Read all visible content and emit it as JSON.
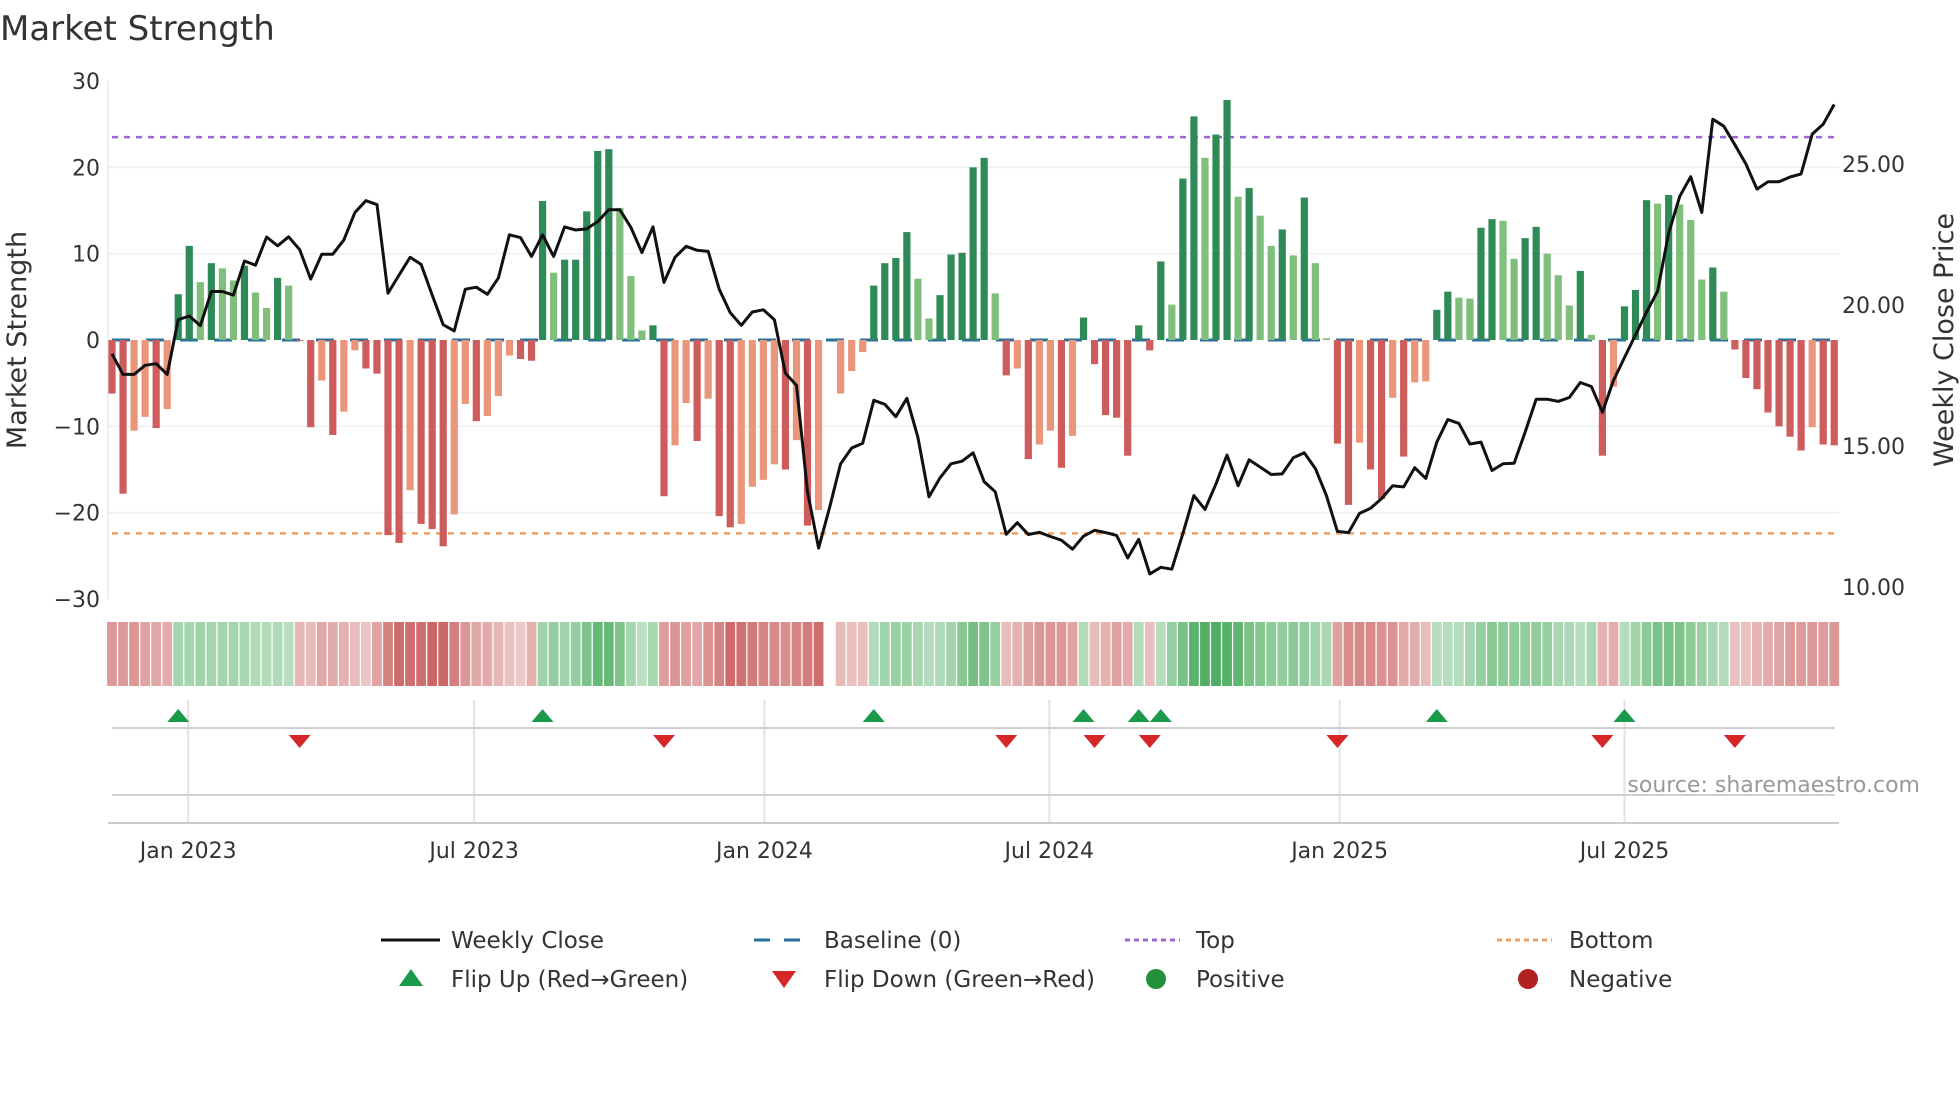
{
  "chart_data": {
    "type": "bar",
    "title": "Market Strength",
    "ylabel": "Market Strength",
    "y2label": "Weekly Close Price",
    "ylim": [
      -30,
      30
    ],
    "y2lim": [
      9.6,
      27.95
    ],
    "yticks": [
      30,
      20,
      10,
      0,
      -10,
      -20,
      -30
    ],
    "yticklabels": [
      "30",
      "20",
      "10",
      "0",
      "−10",
      "−20",
      "−30"
    ],
    "y2ticks": [
      25,
      20,
      15,
      10
    ],
    "y2ticklabels": [
      "25.00",
      "20.00",
      "15.00",
      "10.00"
    ],
    "xticks": [
      {
        "week": 7.9,
        "label": "Jan 2023"
      },
      {
        "week": 33.8,
        "label": "Jul 2023"
      },
      {
        "week": 60.1,
        "label": "Jan 2024"
      },
      {
        "week": 85.9,
        "label": "Jul 2024"
      },
      {
        "week": 112.2,
        "label": "Jan 2025"
      },
      {
        "week": 138.0,
        "label": "Jul 2025"
      }
    ],
    "top_level": 23.5,
    "bottom_level": -22.4,
    "baseline": 0,
    "strength": [
      -6.2,
      -17.8,
      -10.5,
      -8.9,
      -10.2,
      -8.0,
      5.3,
      10.9,
      6.7,
      8.9,
      8.3,
      6.9,
      8.6,
      5.5,
      3.7,
      7.2,
      6.3,
      -0.1,
      -10.1,
      -4.7,
      -11.0,
      -8.3,
      -1.2,
      -3.3,
      -3.9,
      -22.6,
      -23.5,
      -17.4,
      -21.3,
      -21.9,
      -23.9,
      -20.2,
      -7.4,
      -9.4,
      -8.8,
      -6.5,
      -1.8,
      -2.2,
      -2.4,
      16.1,
      7.8,
      9.3,
      9.3,
      14.9,
      21.9,
      22.1,
      15.3,
      7.4,
      1.1,
      1.7,
      -18.1,
      -12.2,
      -7.3,
      -11.7,
      -6.8,
      -20.4,
      -21.7,
      -21.3,
      -17.0,
      -16.2,
      -14.4,
      -15.0,
      -11.6,
      -21.5,
      -19.7,
      null,
      -6.2,
      -3.6,
      -1.4,
      6.3,
      8.9,
      9.5,
      12.5,
      7.1,
      2.5,
      5.2,
      9.9,
      10.1,
      20.0,
      21.1,
      5.4,
      -4.1,
      -3.3,
      -13.8,
      -12.1,
      -10.5,
      -14.8,
      -11.1,
      2.6,
      -2.8,
      -8.7,
      -9.0,
      -13.4,
      1.7,
      -1.2,
      9.1,
      4.1,
      18.7,
      25.9,
      21.1,
      23.8,
      27.8,
      16.6,
      17.6,
      14.4,
      10.9,
      12.8,
      9.8,
      16.5,
      8.9,
      0.2,
      -12.0,
      -19.1,
      -11.9,
      -15.0,
      -18.4,
      -6.7,
      -13.5,
      -4.9,
      -4.8,
      3.5,
      5.6,
      4.9,
      4.8,
      13.0,
      14.0,
      13.8,
      9.4,
      11.8,
      13.1,
      10.0,
      7.5,
      4.0,
      8.0,
      0.6,
      -13.4,
      -5.4,
      3.9,
      5.8,
      16.2,
      15.8,
      16.8,
      15.7,
      13.9,
      7.0,
      8.4,
      5.6,
      -1.1,
      -4.4,
      -5.7,
      -8.4,
      -10.0,
      -11.2,
      -12.8,
      -10.1,
      -12.1,
      -12.2
    ],
    "weekly_close": [
      18.27,
      17.54,
      17.54,
      17.86,
      17.92,
      17.54,
      19.48,
      19.61,
      19.27,
      20.48,
      20.48,
      20.35,
      21.56,
      21.41,
      22.41,
      22.1,
      22.42,
      21.96,
      20.92,
      21.8,
      21.8,
      22.3,
      23.28,
      23.7,
      23.56,
      20.42,
      21.06,
      21.69,
      21.44,
      20.35,
      19.3,
      19.08,
      20.56,
      20.63,
      20.38,
      20.96,
      22.49,
      22.39,
      21.72,
      22.49,
      21.72,
      22.77,
      22.66,
      22.7,
      22.96,
      23.38,
      23.38,
      22.75,
      21.86,
      22.77,
      20.8,
      21.69,
      22.08,
      21.94,
      21.9,
      20.56,
      19.73,
      19.28,
      19.75,
      19.83,
      19.48,
      17.58,
      17.15,
      13.38,
      11.38,
      12.82,
      14.37,
      14.93,
      15.1,
      16.62,
      16.48,
      16.04,
      16.69,
      15.31,
      13.2,
      13.87,
      14.37,
      14.46,
      14.76,
      13.73,
      13.38,
      11.87,
      12.28,
      11.86,
      11.94,
      11.79,
      11.66,
      11.34,
      11.8,
      12.01,
      11.93,
      11.83,
      11.03,
      11.69,
      10.46,
      10.7,
      10.63,
      11.9,
      13.24,
      12.75,
      13.66,
      14.68,
      13.59,
      14.51,
      14.25,
      13.99,
      14.01,
      14.58,
      14.76,
      14.2,
      13.24,
      11.97,
      11.93,
      12.61,
      12.79,
      13.14,
      13.59,
      13.55,
      14.23,
      13.85,
      15.14,
      15.94,
      15.8,
      15.07,
      15.14,
      14.13,
      14.37,
      14.39,
      15.49,
      16.66,
      16.66,
      16.58,
      16.72,
      17.25,
      17.11,
      16.2,
      17.32,
      18.14,
      18.94,
      19.75,
      20.49,
      22.54,
      23.85,
      24.55,
      23.28,
      26.59,
      26.34,
      25.68,
      25.0,
      24.11,
      24.37,
      24.37,
      24.54,
      24.65,
      26.06,
      26.41,
      27.11
    ],
    "legend": {
      "position": "bottom",
      "items": [
        {
          "label": "Weekly Close",
          "kind": "line"
        },
        {
          "label": "Baseline (0)",
          "kind": "dash"
        },
        {
          "label": "Top",
          "kind": "dot-top"
        },
        {
          "label": "Bottom",
          "kind": "dot-bottom"
        },
        {
          "label": "Flip Up (Red→Green)",
          "kind": "tri-up"
        },
        {
          "label": "Flip Down (Green→Red)",
          "kind": "tri-down"
        },
        {
          "label": "Positive",
          "kind": "circle-pos"
        },
        {
          "label": "Negative",
          "kind": "circle-neg"
        }
      ]
    },
    "source": "source: sharemaestro.com",
    "colors": {
      "pos_strong": "#2e8b57",
      "pos_weak": "#7fbf7b",
      "neg_strong": "#cd5c5c",
      "neg_weak": "#e9967a",
      "baseline": "#2a6f9e",
      "top": "#a064d8",
      "bottom": "#f0a060",
      "line": "#111111",
      "flip_up": "#1a9a4a",
      "flip_down": "#d62728",
      "positive": "#22903a",
      "negative": "#b22222"
    }
  }
}
